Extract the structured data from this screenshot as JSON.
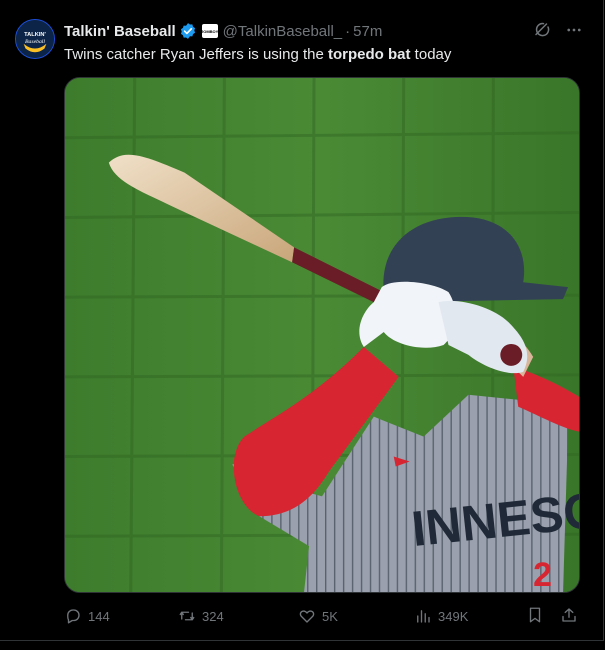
{
  "tweet": {
    "author_name": "Talkin' Baseball",
    "handle": "@TalkinBaseball_",
    "separator": "·",
    "time": "57m",
    "text_before": "Twins catcher Ryan Jeffers is using the ",
    "text_bold": "torpedo bat",
    "text_after": " today",
    "avatar_text_top": "TALKIN'",
    "avatar_text_bottom": "Baseball",
    "affiliate_badge_text": "JOMBOY",
    "media_jersey_text": "INNESOT",
    "media_number_text": "2"
  },
  "actions": {
    "replies": "144",
    "reposts": "324",
    "likes": "5K",
    "views": "349K"
  },
  "colors": {
    "background": "#000000",
    "text": "#e7e9ea",
    "muted": "#71767b",
    "verified": "#1d9bf0"
  },
  "icons": [
    "verified-badge-icon",
    "grok-icon",
    "more-icon",
    "reply-icon",
    "repost-icon",
    "like-icon",
    "views-icon",
    "bookmark-icon",
    "share-icon"
  ]
}
